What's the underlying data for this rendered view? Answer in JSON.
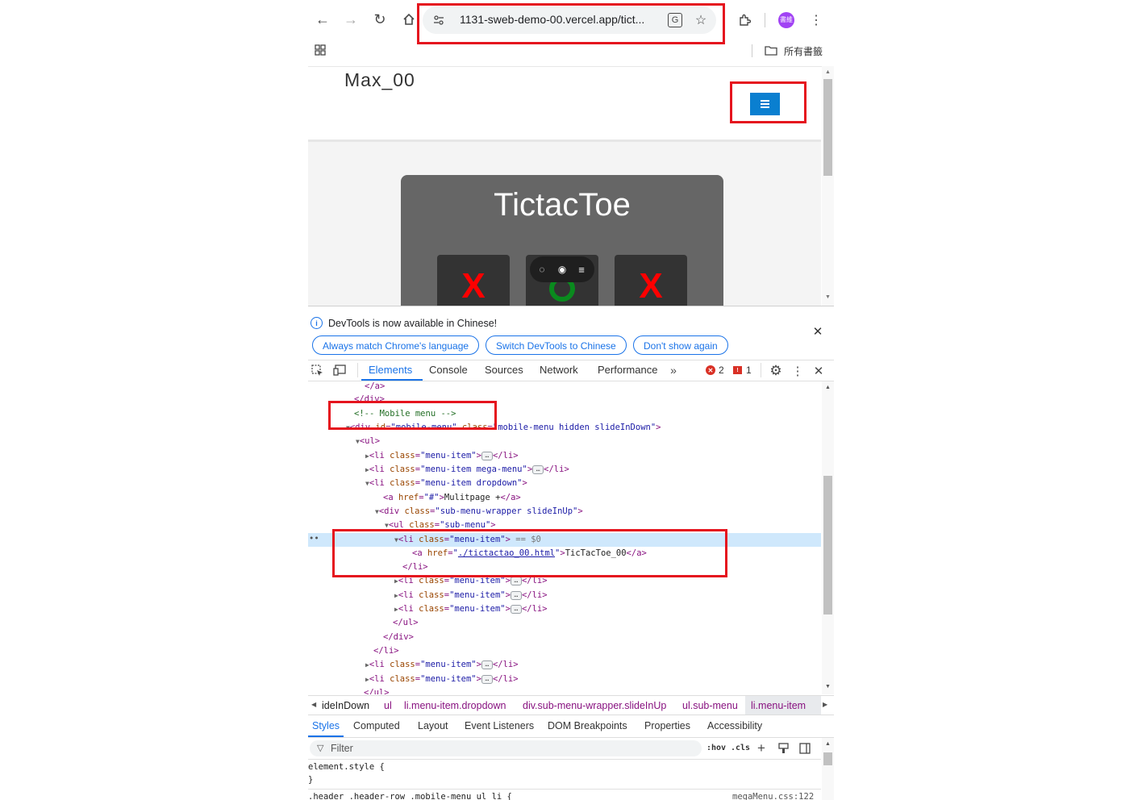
{
  "browser": {
    "url": "1131-sweb-demo-00.vercel.app/tict...",
    "bookmarks_label": "所有書籤",
    "profile_initials": "書維"
  },
  "page": {
    "site_title": "Max_00",
    "game_title": "TictacToe",
    "cells": [
      "X",
      "O",
      "X"
    ]
  },
  "devtools": {
    "notice": "DevTools is now available in Chinese!",
    "btn_match": "Always match Chrome's language",
    "btn_switch": "Switch DevTools to Chinese",
    "btn_dont": "Don't show again",
    "tabs": [
      "Elements",
      "Console",
      "Sources",
      "Network",
      "Performance"
    ],
    "errors": "2",
    "warnings": "1",
    "breadcrumbs": [
      "ideInDown",
      "ul",
      "li.menu-item.dropdown",
      "div.sub-menu-wrapper.slideInUp",
      "ul.sub-menu",
      "li.menu-item"
    ],
    "style_tabs": [
      "Styles",
      "Computed",
      "Layout",
      "Event Listeners",
      "DOM Breakpoints",
      "Properties",
      "Accessibility"
    ],
    "filter_placeholder": "Filter",
    "hov": ":hov",
    "cls": ".cls",
    "element_style": "element.style {",
    "close_brace": "}",
    "rule_selector": ".header .header-row .mobile-menu ul li {",
    "rule_source": "megaMenu.css:122"
  },
  "colors": {
    "accent": "#1a73e8",
    "menu_button": "#0a7fd0",
    "highlight": "#e5141e",
    "x_mark": "#ff0000",
    "o_mark": "#0a8a1e"
  }
}
